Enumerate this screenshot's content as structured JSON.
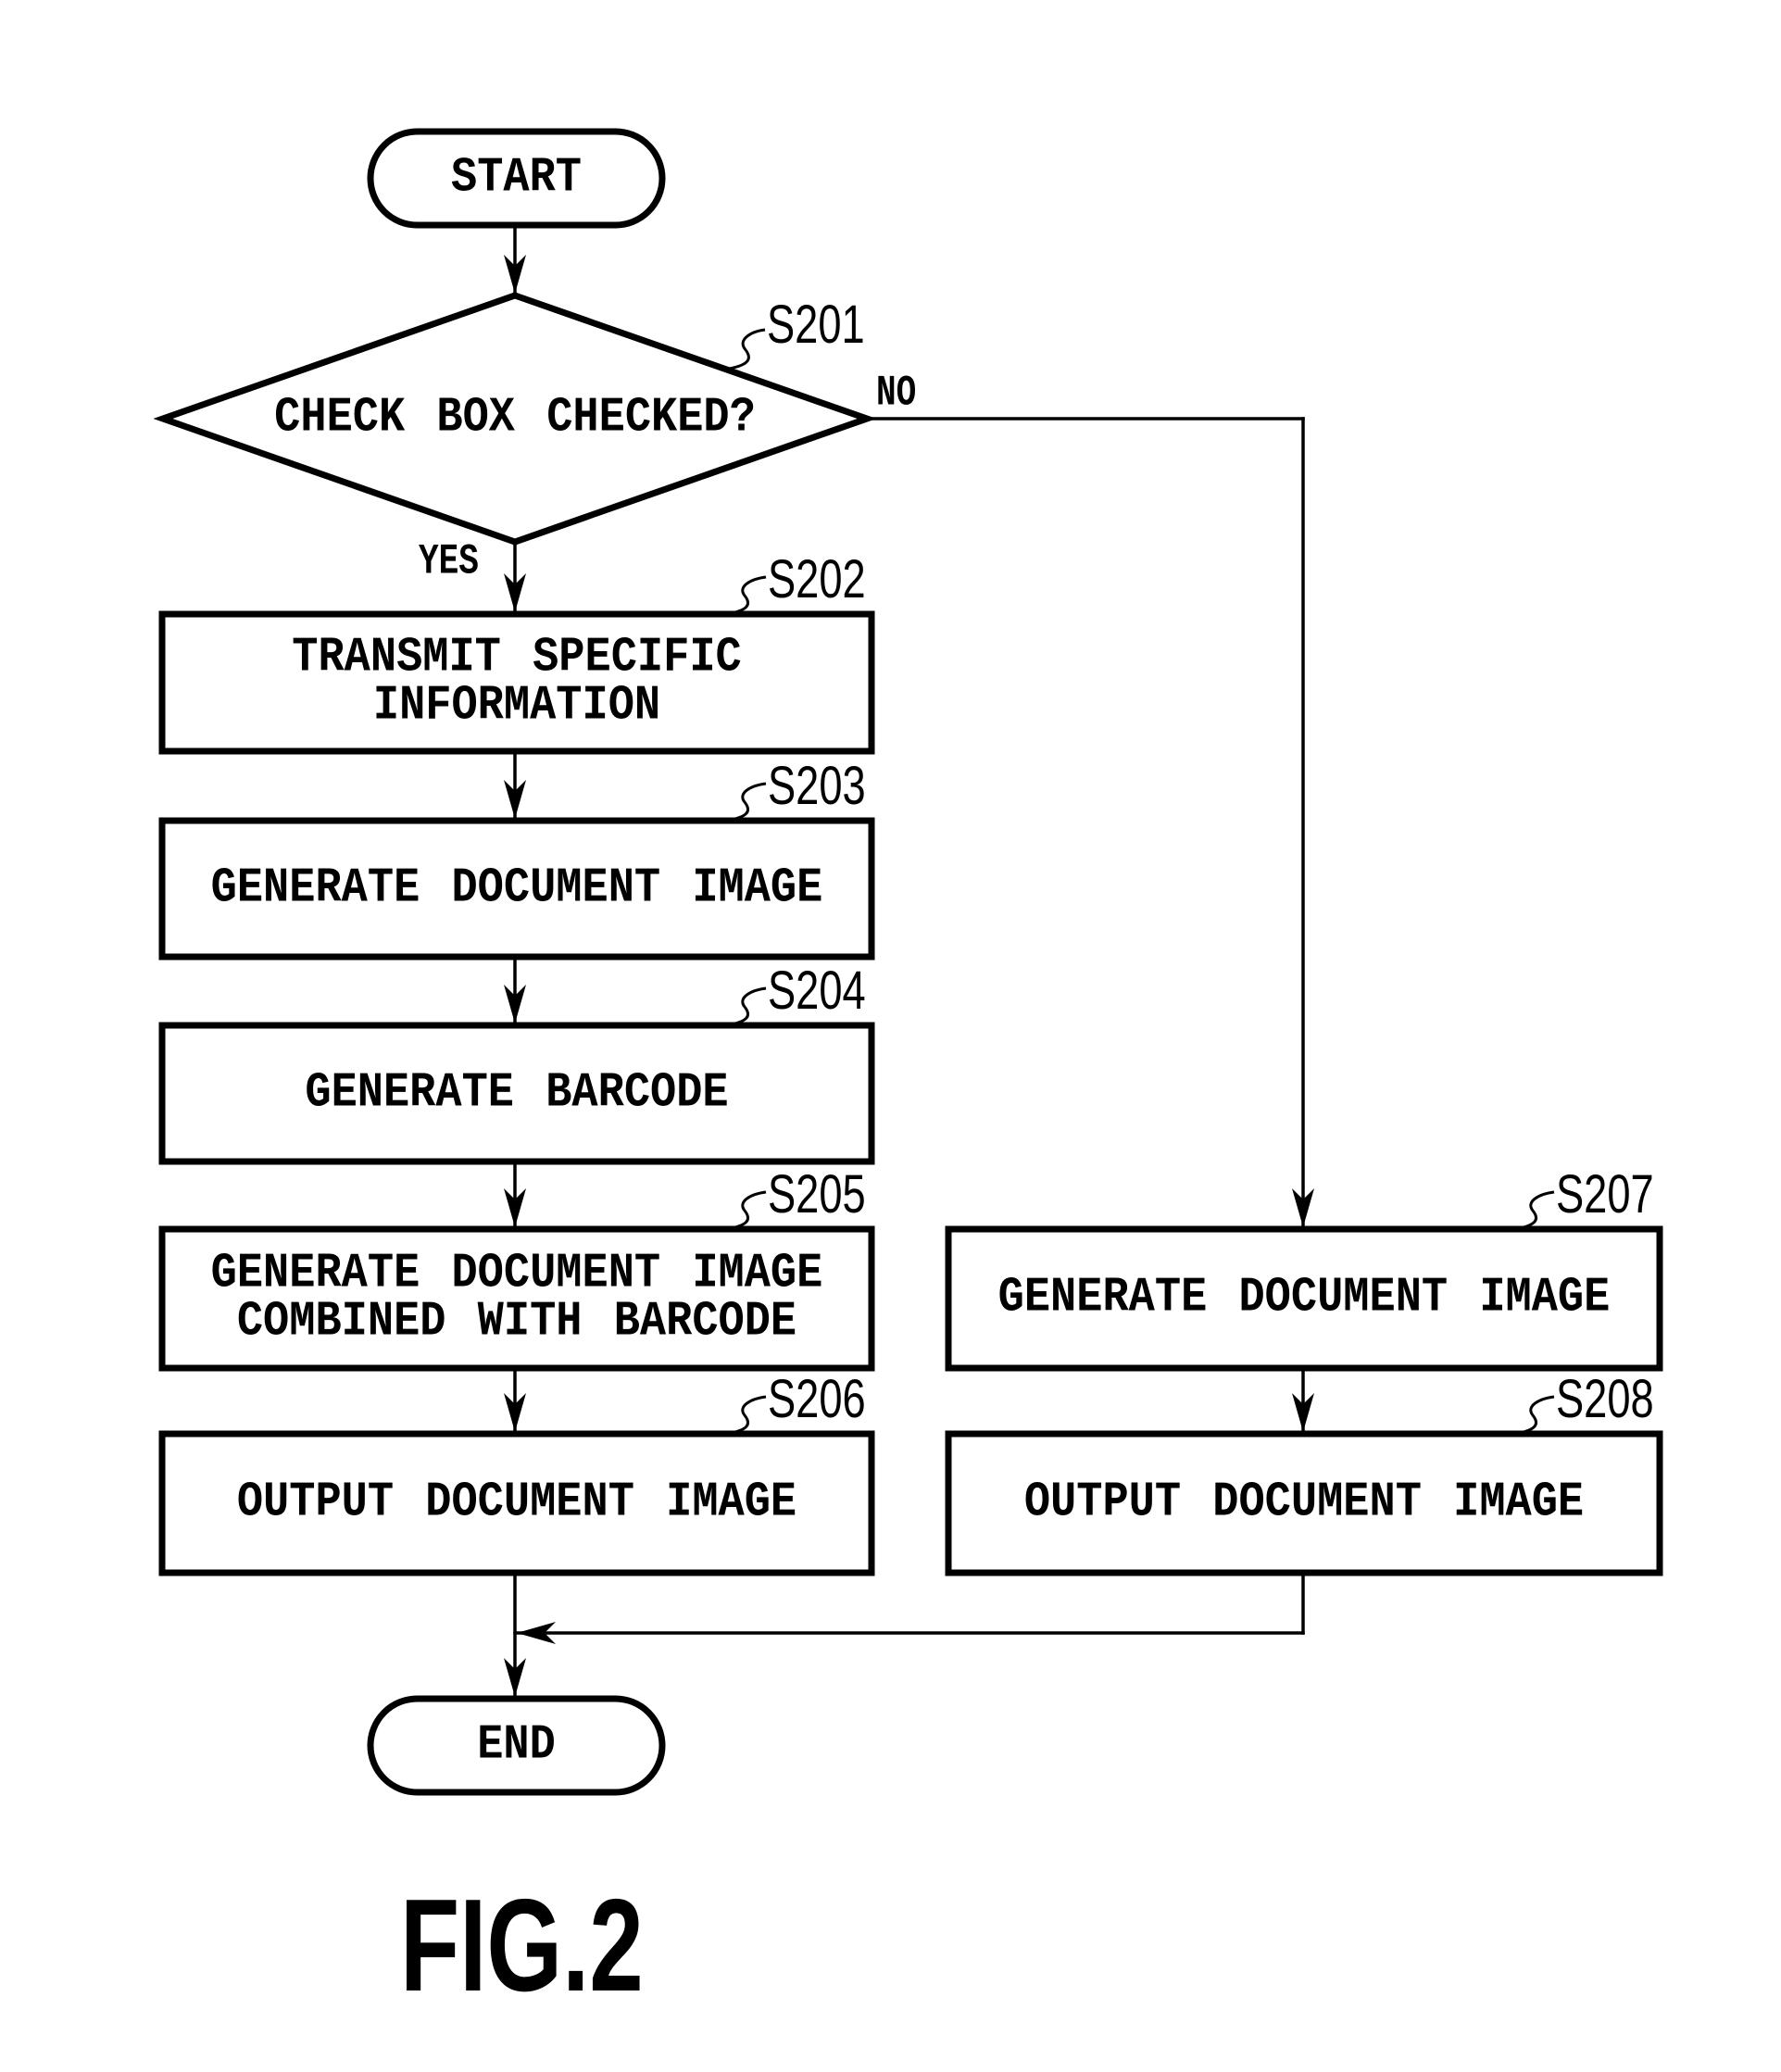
{
  "figure": {
    "caption": "FIG.2",
    "type": "flowchart"
  },
  "nodes": {
    "start": {
      "kind": "terminator",
      "label": [
        "START"
      ]
    },
    "s201": {
      "kind": "decision",
      "step": "S201",
      "label": [
        "CHECK BOX CHECKED?"
      ]
    },
    "s202": {
      "kind": "process",
      "step": "S202",
      "label": [
        "TRANSMIT SPECIFIC",
        "INFORMATION"
      ]
    },
    "s203": {
      "kind": "process",
      "step": "S203",
      "label": [
        "GENERATE DOCUMENT IMAGE"
      ]
    },
    "s204": {
      "kind": "process",
      "step": "S204",
      "label": [
        "GENERATE BARCODE"
      ]
    },
    "s205": {
      "kind": "process",
      "step": "S205",
      "label": [
        "GENERATE DOCUMENT IMAGE",
        "COMBINED WITH BARCODE"
      ]
    },
    "s206": {
      "kind": "process",
      "step": "S206",
      "label": [
        "OUTPUT DOCUMENT IMAGE"
      ]
    },
    "s207": {
      "kind": "process",
      "step": "S207",
      "label": [
        "GENERATE DOCUMENT IMAGE"
      ]
    },
    "s208": {
      "kind": "process",
      "step": "S208",
      "label": [
        "OUTPUT DOCUMENT IMAGE"
      ]
    },
    "end": {
      "kind": "terminator",
      "label": [
        "END"
      ]
    }
  },
  "edges": [
    {
      "from": "start",
      "to": "s201"
    },
    {
      "from": "s201",
      "to": "s202",
      "label": "YES"
    },
    {
      "from": "s201",
      "to": "s207",
      "label": "NO"
    },
    {
      "from": "s202",
      "to": "s203"
    },
    {
      "from": "s203",
      "to": "s204"
    },
    {
      "from": "s204",
      "to": "s205"
    },
    {
      "from": "s205",
      "to": "s206"
    },
    {
      "from": "s207",
      "to": "s208"
    },
    {
      "from": "s206",
      "to": "end"
    },
    {
      "from": "s208",
      "to": "end"
    }
  ],
  "branch_labels": {
    "yes": "YES",
    "no": "NO"
  },
  "colors": {
    "ink": "#000000",
    "paper": "#ffffff"
  }
}
